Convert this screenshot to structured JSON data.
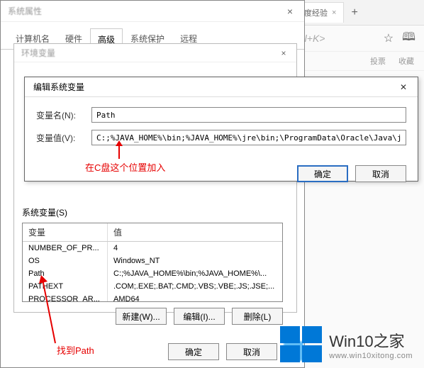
{
  "browser": {
    "tab_label": "百度经验",
    "tab_add": "+",
    "addressbar_hint": "Ctrl+K>",
    "sub_items": [
      "投票",
      "收藏"
    ]
  },
  "sysprops": {
    "title": "系统属性",
    "tabs": [
      "计算机名",
      "硬件",
      "高级",
      "系统保护",
      "远程"
    ],
    "active_tab": "高级"
  },
  "env": {
    "title": "环境变量"
  },
  "edit": {
    "title": "编辑系统变量",
    "name_label": "变量名(N):",
    "name_value": "Path",
    "value_label": "变量值(V):",
    "value_value": "C:;%JAVA_HOME%\\bin;%JAVA_HOME%\\jre\\bin;\\ProgramData\\Oracle\\Java\\javapath;%S",
    "ok": "确定",
    "cancel": "取消"
  },
  "annotations": {
    "top": "在C盘这个位置加入",
    "bottom": "找到Path"
  },
  "sysvars": {
    "label": "系统变量(S)",
    "col_name": "变量",
    "col_value": "值",
    "rows": [
      {
        "name": "NUMBER_OF_PR...",
        "value": "4"
      },
      {
        "name": "OS",
        "value": "Windows_NT"
      },
      {
        "name": "Path",
        "value": "C:;%JAVA_HOME%\\bin;%JAVA_HOME%\\..."
      },
      {
        "name": "PATHEXT",
        "value": ".COM;.EXE;.BAT;.CMD;.VBS;.VBE;.JS;.JSE;..."
      },
      {
        "name": "PROCESSOR_AR...",
        "value": "AMD64"
      }
    ],
    "btn_new": "新建(W)...",
    "btn_edit": "编辑(I)...",
    "btn_del": "删除(L)"
  },
  "bottom": {
    "ok": "确定",
    "cancel": "取消"
  },
  "logo": {
    "big": "Win10之家",
    "small": "www.win10xitong.com"
  }
}
